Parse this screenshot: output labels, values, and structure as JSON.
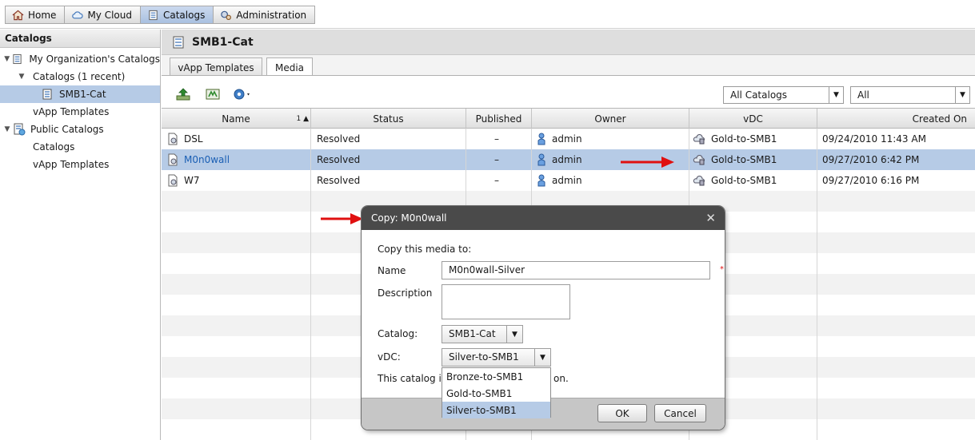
{
  "nav": {
    "tabs": [
      {
        "label": "Home",
        "icon": "home-icon"
      },
      {
        "label": "My Cloud",
        "icon": "cloud-icon"
      },
      {
        "label": "Catalogs",
        "icon": "catalog-icon"
      },
      {
        "label": "Administration",
        "icon": "admin-gears-icon"
      }
    ],
    "active": "Catalogs"
  },
  "sidebar": {
    "title": "Catalogs",
    "items": [
      {
        "label": "My Organization's Catalogs"
      },
      {
        "label": "Catalogs (1 recent)"
      },
      {
        "label": "SMB1-Cat"
      },
      {
        "label": "vApp Templates"
      },
      {
        "label": "Public Catalogs"
      },
      {
        "label": "Catalogs"
      },
      {
        "label": "vApp Templates"
      }
    ]
  },
  "main": {
    "title": "SMB1-Cat",
    "tabs": [
      {
        "label": "vApp Templates"
      },
      {
        "label": "Media"
      }
    ],
    "filters": {
      "catalog": "All Catalogs",
      "scope": "All"
    }
  },
  "table": {
    "columns": [
      "Name",
      "Status",
      "Published",
      "Owner",
      "vDC",
      "Created On"
    ],
    "sort_indicator": "1 ▲",
    "rows": [
      {
        "name": "DSL",
        "status": "Resolved",
        "published": "–",
        "owner": "admin",
        "vdc": "Gold-to-SMB1",
        "created": "09/24/2010 11:43 AM"
      },
      {
        "name": "M0n0wall",
        "status": "Resolved",
        "published": "–",
        "owner": "admin",
        "vdc": "Gold-to-SMB1",
        "created": "09/27/2010 6:42 PM"
      },
      {
        "name": "W7",
        "status": "Resolved",
        "published": "–",
        "owner": "admin",
        "vdc": "Gold-to-SMB1",
        "created": "09/27/2010 6:16 PM"
      }
    ]
  },
  "dialog": {
    "title": "Copy: M0n0wall",
    "intro": "Copy this media to:",
    "name_label": "Name",
    "name_value": "M0n0wall-Silver",
    "description_label": "Description",
    "catalog_label": "Catalog:",
    "catalog_value": "SMB1-Cat",
    "vdc_label": "vDC:",
    "vdc_value": "Silver-to-SMB1",
    "note_start": "This catalog is",
    "note_end": "on.",
    "vdc_options": [
      "Bronze-to-SMB1",
      "Gold-to-SMB1",
      "Silver-to-SMB1"
    ],
    "ok_label": "OK",
    "cancel_label": "Cancel"
  },
  "colors": {
    "selection": "#b6cbe6",
    "dialog_title_bar": "#4a4a4a",
    "annotation_arrow": "#e01010",
    "link_text": "#1a5fb4"
  }
}
